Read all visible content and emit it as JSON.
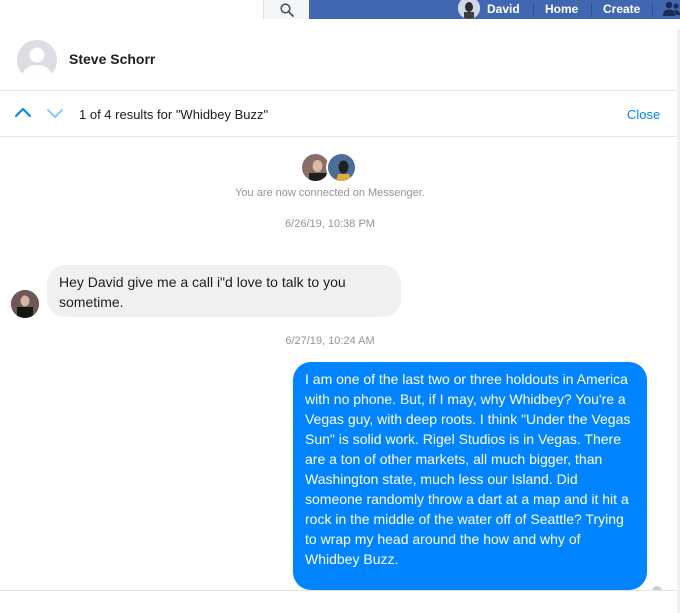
{
  "topbar": {
    "search_placeholder": "",
    "nav_user": "David",
    "nav_home": "Home",
    "nav_create": "Create"
  },
  "conversation": {
    "name": "Steve Schorr"
  },
  "search_results": {
    "count_text": "1 of 4 results for \"Whidbey Buzz\"",
    "close_label": "Close"
  },
  "thread": {
    "connected_text": "You are now connected on Messenger.",
    "stamp_1": "6/26/19, 10:38 PM",
    "message_1": "Hey David give me a call i\"d love to talk to you sometime.",
    "stamp_2": "6/27/19, 10:24 AM",
    "message_2": "I am one of the last two or three holdouts in America with no phone. But, if I may, why Whidbey? You're a Vegas guy, with deep roots. I think \"Under the Vegas Sun\" is solid work. Rigel Studios is in Vegas. There are a ton of other markets, all much bigger, than Washington state, much less our Island. Did someone randomly throw a dart at a map and it hit a rock in the middle of the water off of Seattle? Trying to wrap my head around the how and why of Whidbey Buzz."
  },
  "colors": {
    "nav_blue": "#4267b2",
    "messenger_blue": "#0084ff",
    "incoming_bubble": "#f1f0f0"
  },
  "icons": [
    "search-icon",
    "chevron-up-icon",
    "chevron-down-icon",
    "friends-icon",
    "seen-indicator-icon"
  ]
}
